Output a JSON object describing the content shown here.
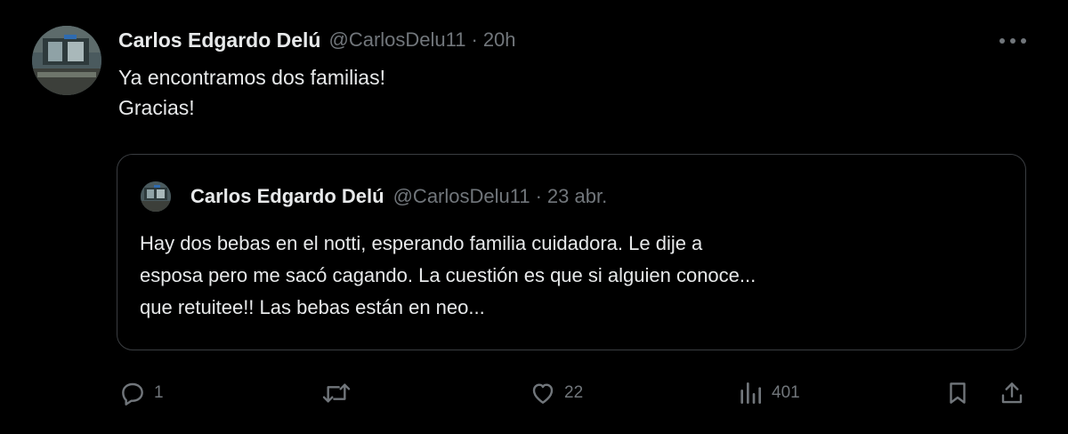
{
  "tweet": {
    "author_name": "Carlos Edgardo Delú",
    "author_handle": "@CarlosDelu11",
    "separator": "·",
    "time": "20h",
    "avatar_icon": "profile-photo",
    "more_icon": "ellipsis-icon",
    "body_lines": [
      "Ya encontramos dos familias!",
      "Gracias!"
    ]
  },
  "quote": {
    "author_name": "Carlos Edgardo Delú",
    "author_handle": "@CarlosDelu11",
    "separator": "·",
    "date": "23 abr.",
    "text_lines": [
      "Hay dos bebas en el notti, esperando familia cuidadora. Le dije a",
      "esposa pero me sacó cagando. La cuestión es que si alguien conoce...",
      "que retuitee!! Las bebas están en neo..."
    ]
  },
  "actions": {
    "replies": "1",
    "retweets": "",
    "likes": "22",
    "views": "401",
    "icons": [
      "reply-icon",
      "retweet-icon",
      "like-icon",
      "views-icon",
      "bookmark-icon",
      "share-icon"
    ]
  },
  "colors": {
    "background": "#000000",
    "text": "#e7e9ea",
    "muted": "#71767b",
    "border": "#3a3d41"
  }
}
